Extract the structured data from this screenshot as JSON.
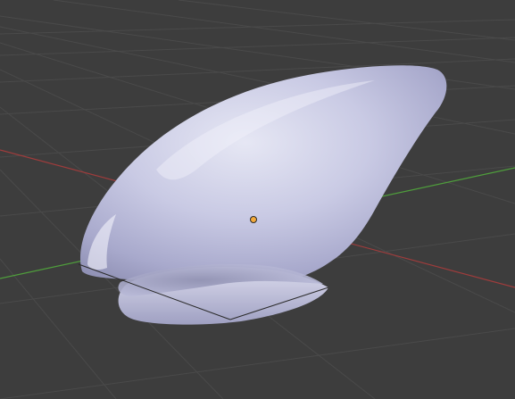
{
  "viewport": {
    "background_color": "#3d3d3d",
    "grid_color": "#4a4a4a",
    "x_axis_color": "#9e3c3c",
    "y_axis_color": "#4f9e3c",
    "selection_edge_color": "#2a2a2a",
    "object_color": "#cfd0e6",
    "object_origin_color": "#f3a93a"
  },
  "object": {
    "name_icon": "mesh-object-icon",
    "origin_icon": "object-origin-icon"
  }
}
